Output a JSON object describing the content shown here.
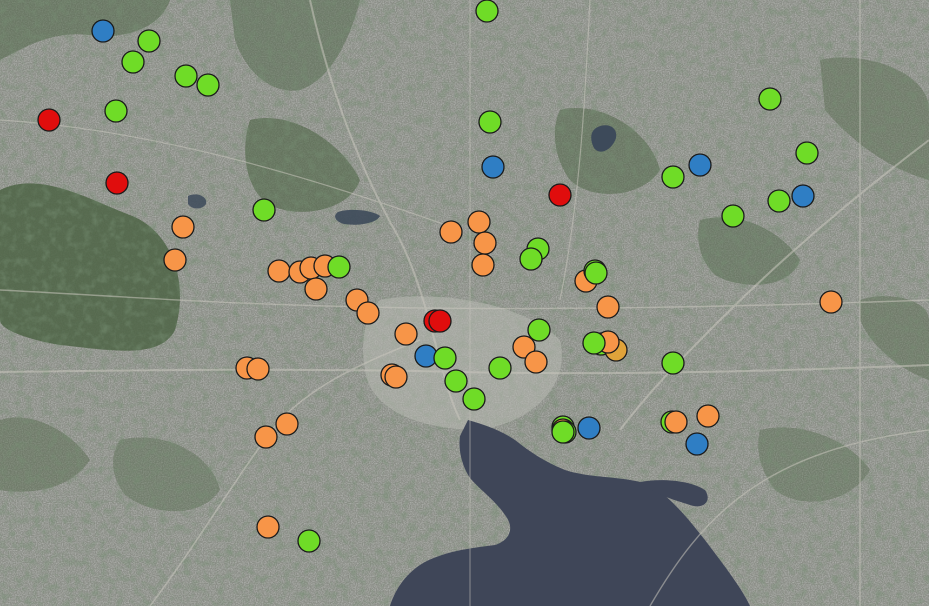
{
  "map": {
    "basemap": "satellite-imagery",
    "colors": {
      "red": "#e00d0d",
      "orange": "#f79548",
      "green": "#6fdc27",
      "blue": "#2f7ec4",
      "amber": "#e0a33a"
    },
    "markers": [
      {
        "category": "blue"
      },
      {
        "category": "green"
      },
      {
        "category": "green"
      },
      {
        "category": "green"
      },
      {
        "category": "green"
      },
      {
        "category": "green"
      },
      {
        "category": "red"
      },
      {
        "category": "red"
      },
      {
        "category": "green"
      },
      {
        "category": "orange"
      },
      {
        "category": "orange"
      },
      {
        "category": "orange"
      },
      {
        "category": "orange"
      },
      {
        "category": "orange"
      },
      {
        "category": "orange"
      },
      {
        "category": "green"
      },
      {
        "category": "orange"
      },
      {
        "category": "orange"
      },
      {
        "category": "orange"
      },
      {
        "category": "orange"
      },
      {
        "category": "orange"
      },
      {
        "category": "orange"
      },
      {
        "category": "orange"
      },
      {
        "category": "orange"
      },
      {
        "category": "orange"
      },
      {
        "category": "orange"
      },
      {
        "category": "orange"
      },
      {
        "category": "green"
      },
      {
        "category": "green"
      },
      {
        "category": "green"
      },
      {
        "category": "blue"
      },
      {
        "category": "red"
      },
      {
        "category": "orange"
      },
      {
        "category": "orange"
      },
      {
        "category": "orange"
      },
      {
        "category": "green"
      },
      {
        "category": "green"
      },
      {
        "category": "red"
      },
      {
        "category": "red"
      },
      {
        "category": "orange"
      },
      {
        "category": "blue"
      },
      {
        "category": "green"
      },
      {
        "category": "green"
      },
      {
        "category": "green"
      },
      {
        "category": "green"
      },
      {
        "category": "green"
      },
      {
        "category": "orange"
      },
      {
        "category": "orange"
      },
      {
        "category": "green"
      },
      {
        "category": "orange"
      },
      {
        "category": "blue"
      },
      {
        "category": "orange"
      },
      {
        "category": "green"
      },
      {
        "category": "green"
      },
      {
        "category": "orange"
      },
      {
        "category": "green"
      },
      {
        "category": "amber"
      },
      {
        "category": "orange"
      },
      {
        "category": "green"
      },
      {
        "category": "green"
      },
      {
        "category": "green"
      },
      {
        "category": "orange"
      },
      {
        "category": "blue"
      },
      {
        "category": "orange"
      },
      {
        "category": "blue"
      },
      {
        "category": "green"
      },
      {
        "category": "green"
      },
      {
        "category": "green"
      },
      {
        "category": "green"
      },
      {
        "category": "blue"
      },
      {
        "category": "green"
      },
      {
        "category": "orange"
      },
      {
        "category": "green"
      },
      {
        "category": "green"
      }
    ]
  }
}
